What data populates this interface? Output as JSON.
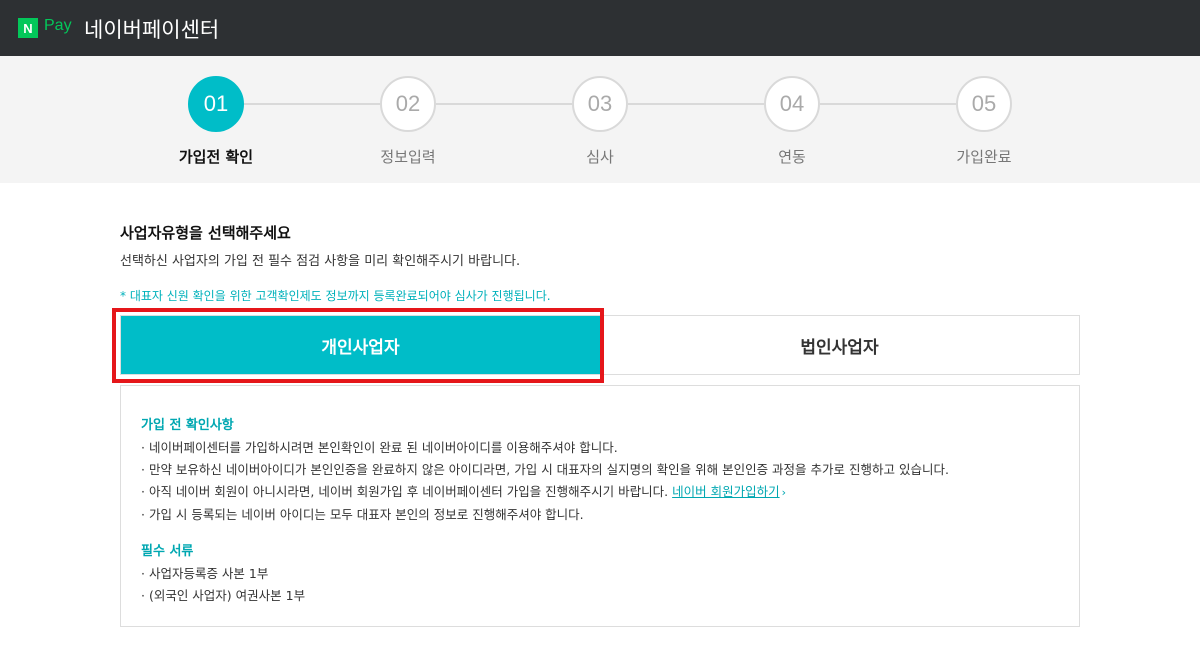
{
  "header": {
    "logo_mark": "N",
    "logo_text": "Pay",
    "title": "네이버페이센터"
  },
  "steps": [
    {
      "number": "01",
      "label": "가입전 확인",
      "active": true
    },
    {
      "number": "02",
      "label": "정보입력",
      "active": false
    },
    {
      "number": "03",
      "label": "심사",
      "active": false
    },
    {
      "number": "04",
      "label": "연동",
      "active": false
    },
    {
      "number": "05",
      "label": "가입완료",
      "active": false
    }
  ],
  "main": {
    "title": "사업자유형을 선택해주세요",
    "description": "선택하신 사업자의 가입 전 필수 점검 사항을 미리 확인해주시기 바랍니다.",
    "notice": "* 대표자 신원 확인을 위한 고객확인제도 정보까지 등록완료되어야 심사가 진행됩니다.",
    "tabs": [
      {
        "label": "개인사업자",
        "selected": true
      },
      {
        "label": "법인사업자",
        "selected": false
      }
    ]
  },
  "info": {
    "check_heading": "가입 전 확인사항",
    "check_items": [
      "· 네이버페이센터를 가입하시려면 본인확인이 완료 된 네이버아이디를 이용해주셔야 합니다.",
      "· 만약 보유하신 네이버아이디가 본인인증을 완료하지 않은 아이디라면, 가입 시 대표자의 실지명의 확인을 위해 본인인증 과정을 추가로 진행하고 있습니다.",
      "· 아직 네이버 회원이 아니시라면, 네이버 회원가입 후 네이버페이센터 가입을 진행해주시기 바랍니다. ",
      "· 가입 시 등록되는 네이버 아이디는 모두 대표자 본인의 정보로 진행해주셔야 합니다."
    ],
    "signup_link": "네이버 회원가입하기",
    "docs_heading": "필수 서류",
    "docs_items": [
      "· 사업자등록증 사본 1부",
      "· (외국인 사업자) 여권사본 1부"
    ]
  },
  "colors": {
    "accent": "#00bdc8",
    "highlight": "#e5161a",
    "header_bg": "#2d3033",
    "brand_green": "#03c75a"
  }
}
